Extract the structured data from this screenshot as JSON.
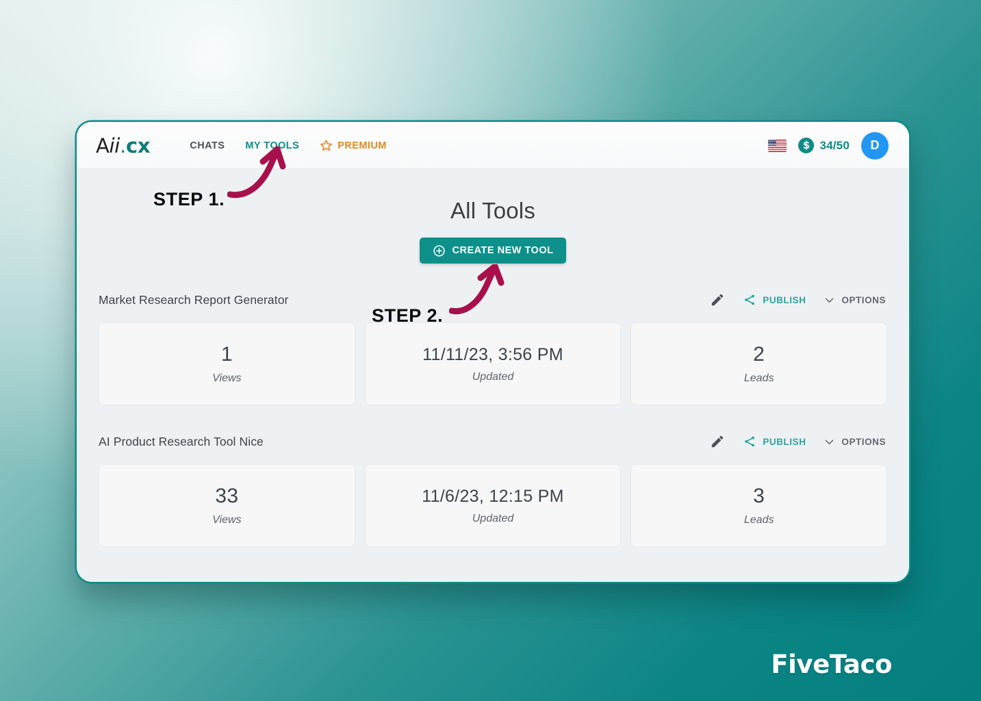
{
  "header": {
    "logo": {
      "part1": "A",
      "part2": "ii",
      "dot": ".",
      "part3": "cx"
    },
    "nav": [
      {
        "label": "CHATS",
        "active": false
      },
      {
        "label": "MY TOOLS",
        "active": true
      },
      {
        "label": "PREMIUM",
        "active": false,
        "icon": "star-icon"
      }
    ],
    "flag_icon": "us-flag-icon",
    "credits": {
      "icon": "dollar-coin-icon",
      "value": "34/50"
    },
    "avatar": {
      "initial": "D"
    }
  },
  "main": {
    "title": "All Tools",
    "create_button": {
      "label": "CREATE NEW TOOL",
      "icon": "plus-circle-icon"
    },
    "actions": {
      "edit_icon": "pencil-icon",
      "publish_label": "PUBLISH",
      "publish_icon": "share-icon",
      "options_label": "OPTIONS",
      "options_icon": "chevron-down-icon"
    },
    "tools": [
      {
        "name": "Market Research Report Generator",
        "stats": [
          {
            "value": "1",
            "label": "Views"
          },
          {
            "value": "11/11/23, 3:56 PM",
            "label": "Updated"
          },
          {
            "value": "2",
            "label": "Leads"
          }
        ]
      },
      {
        "name": "AI Product Research Tool Nice",
        "stats": [
          {
            "value": "33",
            "label": "Views"
          },
          {
            "value": "11/6/23, 12:15 PM",
            "label": "Updated"
          },
          {
            "value": "3",
            "label": "Leads"
          }
        ]
      }
    ]
  },
  "annotations": {
    "step1": "STEP 1.",
    "step2": "STEP 2.",
    "arrow_color": "#a8104c"
  },
  "watermark": "FiveTaco",
  "colors": {
    "teal": "#0d8c87",
    "button_teal": "#0d908a",
    "orange": "#e4891f",
    "avatar_blue": "#2196f3",
    "arrow_crimson": "#a8104c"
  }
}
